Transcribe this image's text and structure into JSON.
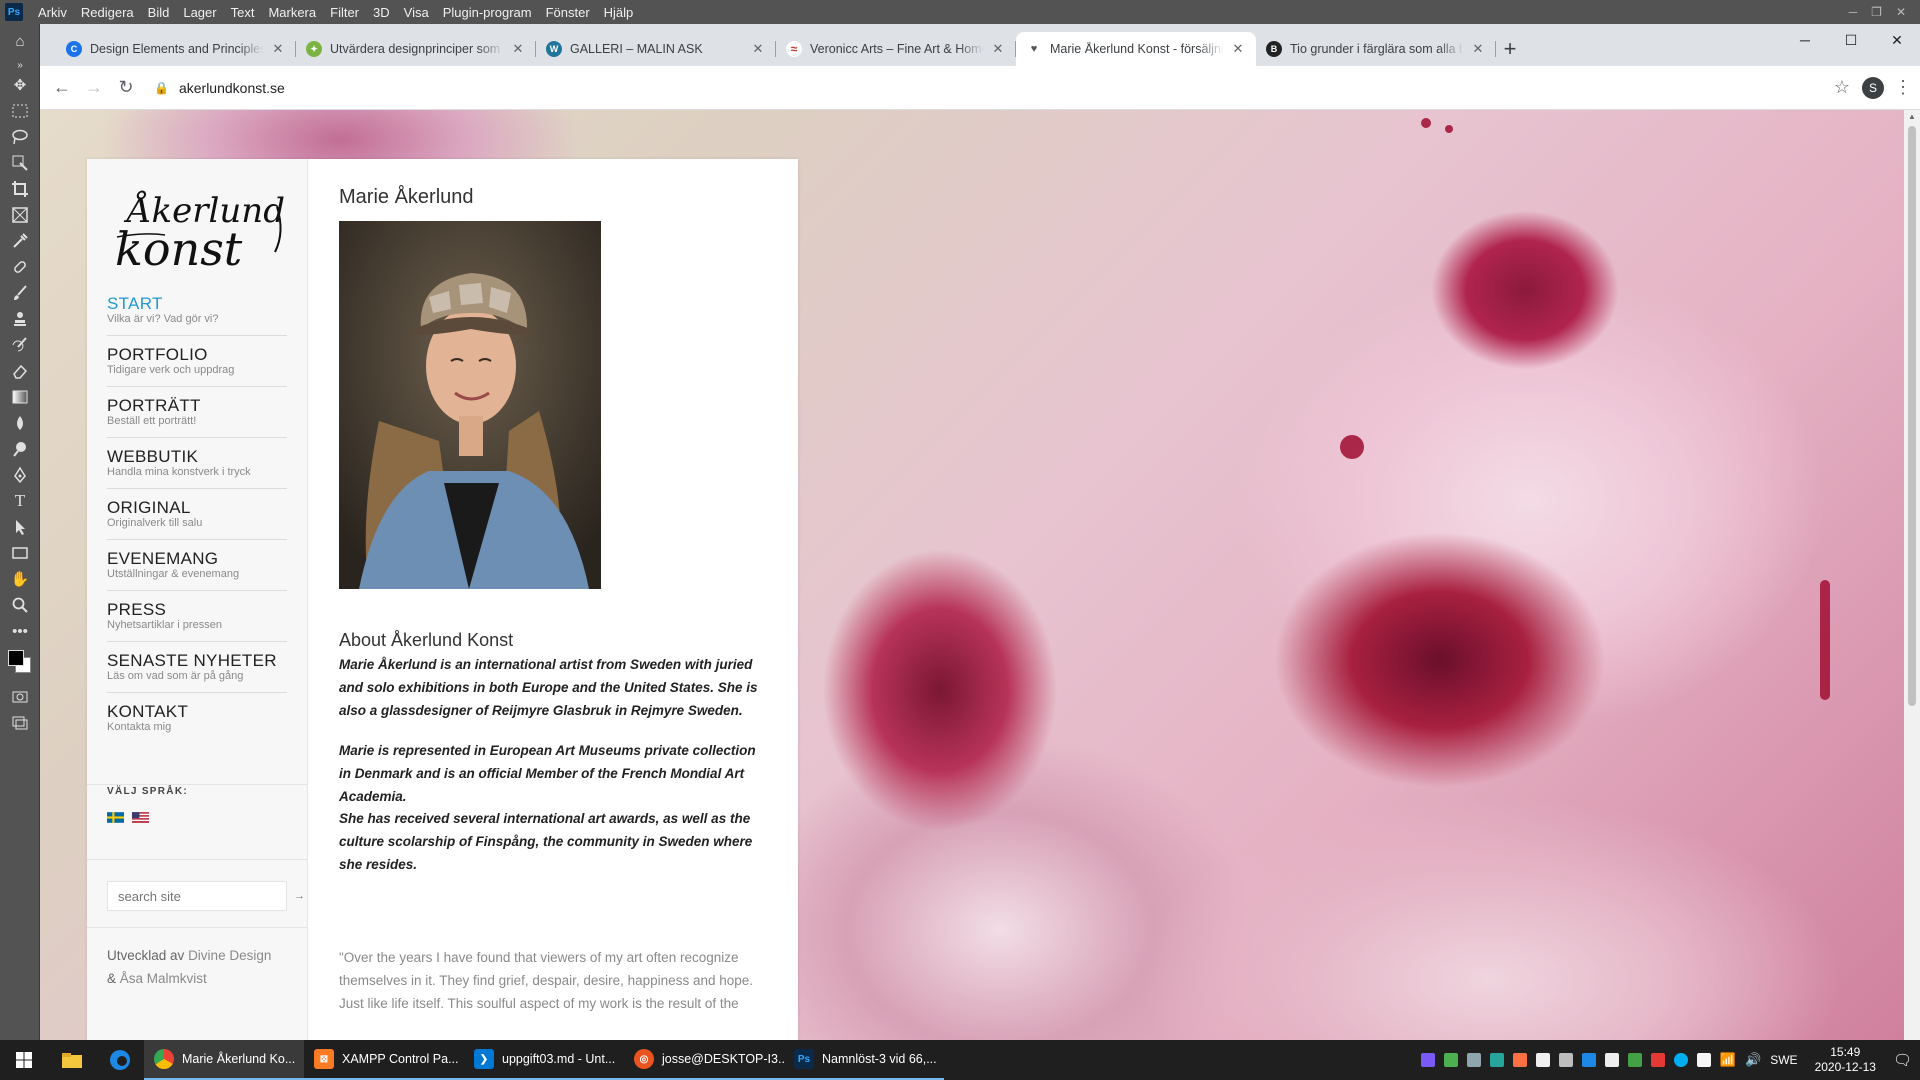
{
  "photoshop": {
    "menu": [
      "Arkiv",
      "Redigera",
      "Bild",
      "Lager",
      "Text",
      "Markera",
      "Filter",
      "3D",
      "Visa",
      "Plugin-program",
      "Fönster",
      "Hjälp"
    ]
  },
  "browser": {
    "tabs": [
      {
        "title": "Design Elements and Principles -",
        "icon_color": "#1a73e8",
        "icon_letter": "C"
      },
      {
        "title": "Utvärdera designprinciper som v",
        "icon_color": "#7cb342",
        "icon_letter": "✦"
      },
      {
        "title": "GALLERI – MALIN ASK",
        "icon_color": "#21759b",
        "icon_letter": "W"
      },
      {
        "title": "Veronicc Arts – Fine Art & Home",
        "icon_color": "#c0392b",
        "icon_letter": "≈"
      },
      {
        "title": "Marie Åkerlund Konst - försäljnin",
        "icon_color": "#555555",
        "icon_letter": "♥"
      },
      {
        "title": "Tio grunder i färglära som alla bö",
        "icon_color": "#222222",
        "icon_letter": "B"
      }
    ],
    "url": "akerlundkonst.se",
    "profile_initial": "S"
  },
  "site": {
    "logo_line1": "Åkerlund",
    "logo_line2": "konst",
    "nav": [
      {
        "label": "START",
        "sub": "Vilka är vi? Vad gör vi?"
      },
      {
        "label": "PORTFOLIO",
        "sub": "Tidigare verk och uppdrag"
      },
      {
        "label": "PORTRÄTT",
        "sub": "Beställ ett porträtt!"
      },
      {
        "label": "WEBBUTIK",
        "sub": "Handla mina konstverk i tryck"
      },
      {
        "label": "ORIGINAL",
        "sub": "Originalverk till salu"
      },
      {
        "label": "EVENEMANG",
        "sub": "Utställningar & evenemang"
      },
      {
        "label": "PRESS",
        "sub": "Nyhetsartiklar i pressen"
      },
      {
        "label": "SENASTE NYHETER",
        "sub": "Läs om vad som är på gång"
      },
      {
        "label": "KONTAKT",
        "sub": "Kontakta mig"
      }
    ],
    "language_title": "VÄLJ SPRÅK:",
    "search_placeholder": "search site",
    "credit_prefix": "Utvecklad av",
    "credit_link1": "Divine Design",
    "credit_amp": "&",
    "credit_link2": "Åsa Malmkvist",
    "page_title": "Marie Åkerlund",
    "about_title": "About Åkerlund Konst",
    "bio": [
      "Marie Åkerlund  is an international artist from Sweden with juried and solo exhibitions in both Europe and the United States. She is also a glassdesigner of  Reijmyre Glasbruk in Rejmyre Sweden.",
      "Marie is represented in European Art Museums private collection in Denmark and is an official Member of the French Mondial Art Academia.",
      "She has received several international art awards, as well as the culture scolarship of Finspång,  the community in Sweden where she resides."
    ],
    "quote": "\"Over the years I have found that viewers of my art often recognize themselves in it. They find grief, despair, desire, happiness and hope. Just like life itself. This soulful aspect of my work is the result of the"
  },
  "taskbar": {
    "apps": [
      {
        "label": "Marie Åkerlund Ko...",
        "icon_color": "#4285f4"
      },
      {
        "label": "XAMPP Control Pa...",
        "icon_color": "#fb7a24"
      },
      {
        "label": "uppgift03.md - Unt...",
        "icon_color": "#0078d4"
      },
      {
        "label": "josse@DESKTOP-I3...",
        "icon_color": "#e95420"
      },
      {
        "label": "Namnlöst-3 vid 66,...",
        "icon_color": "#31a8ff"
      }
    ],
    "language": "SWE",
    "time": "15:49",
    "date": "2020-12-13"
  }
}
